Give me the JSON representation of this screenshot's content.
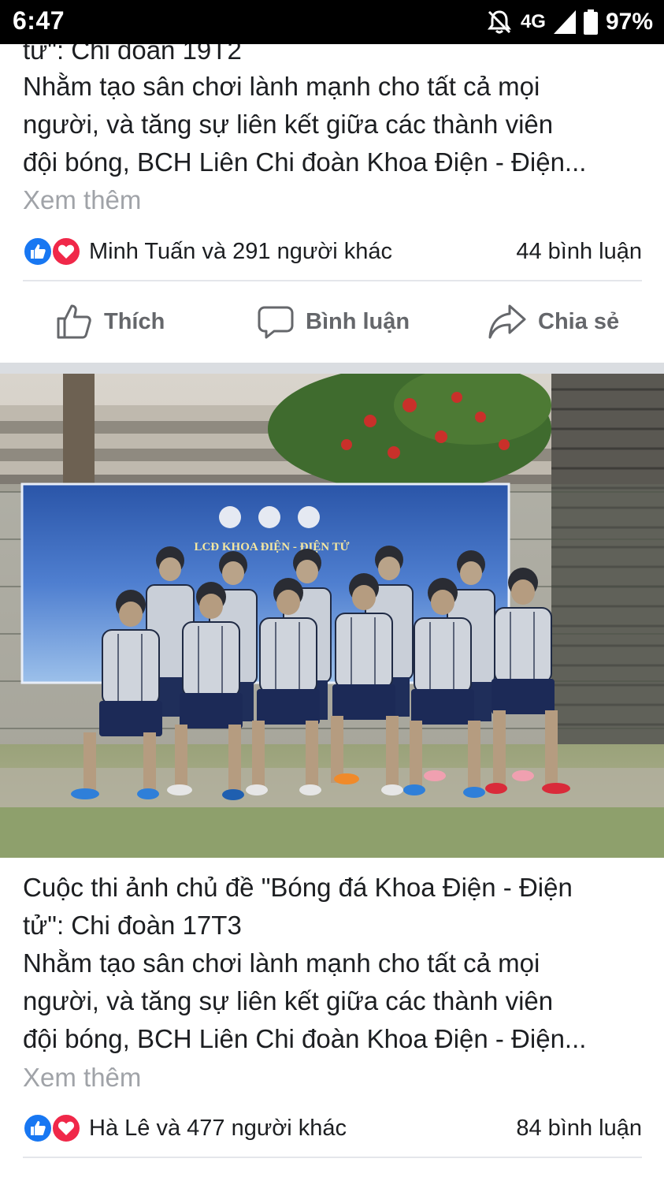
{
  "status_bar": {
    "time": "6:47",
    "network": "4G",
    "battery": "97%",
    "icons": [
      "mute-icon",
      "signal-icon",
      "battery-icon"
    ]
  },
  "post1": {
    "cut_title_line": "tử\": Chi đoàn 19T2",
    "text_lines": [
      "Nhằm tạo sân chơi lành mạnh cho tất cả mọi",
      "người, và tăng sự liên kết giữa các thành viên",
      "đội bóng, BCH Liên Chi đoàn Khoa Điện - Điện..."
    ],
    "see_more": "Xem thêm",
    "reactions_text": "Minh Tuấn và 291 người khác",
    "comments_text": "44 bình luận"
  },
  "actions": {
    "like": "Thích",
    "comment": "Bình luận",
    "share": "Chia sẻ"
  },
  "post2": {
    "photo_banner_text": "LCĐ KHOA ĐIỆN - ĐIỆN TỬ",
    "title_lines": [
      "Cuộc thi ảnh chủ đề \"Bóng đá Khoa Điện - Điện",
      "tử\": Chi đoàn 17T3"
    ],
    "text_lines": [
      "Nhằm tạo sân chơi lành mạnh cho tất cả mọi",
      "người, và tăng sự liên kết giữa các thành viên",
      "đội bóng, BCH Liên Chi đoàn Khoa Điện - Điện..."
    ],
    "see_more": "Xem thêm",
    "reactions_text": "Hà Lê và 477 người khác",
    "comments_text": "84 bình luận"
  },
  "colors": {
    "like_blue": "#1877f2",
    "love_red": "#f02849",
    "secondary_text": "#65676b",
    "see_more_gray": "#a0a3a8",
    "separator": "#dadde1"
  }
}
